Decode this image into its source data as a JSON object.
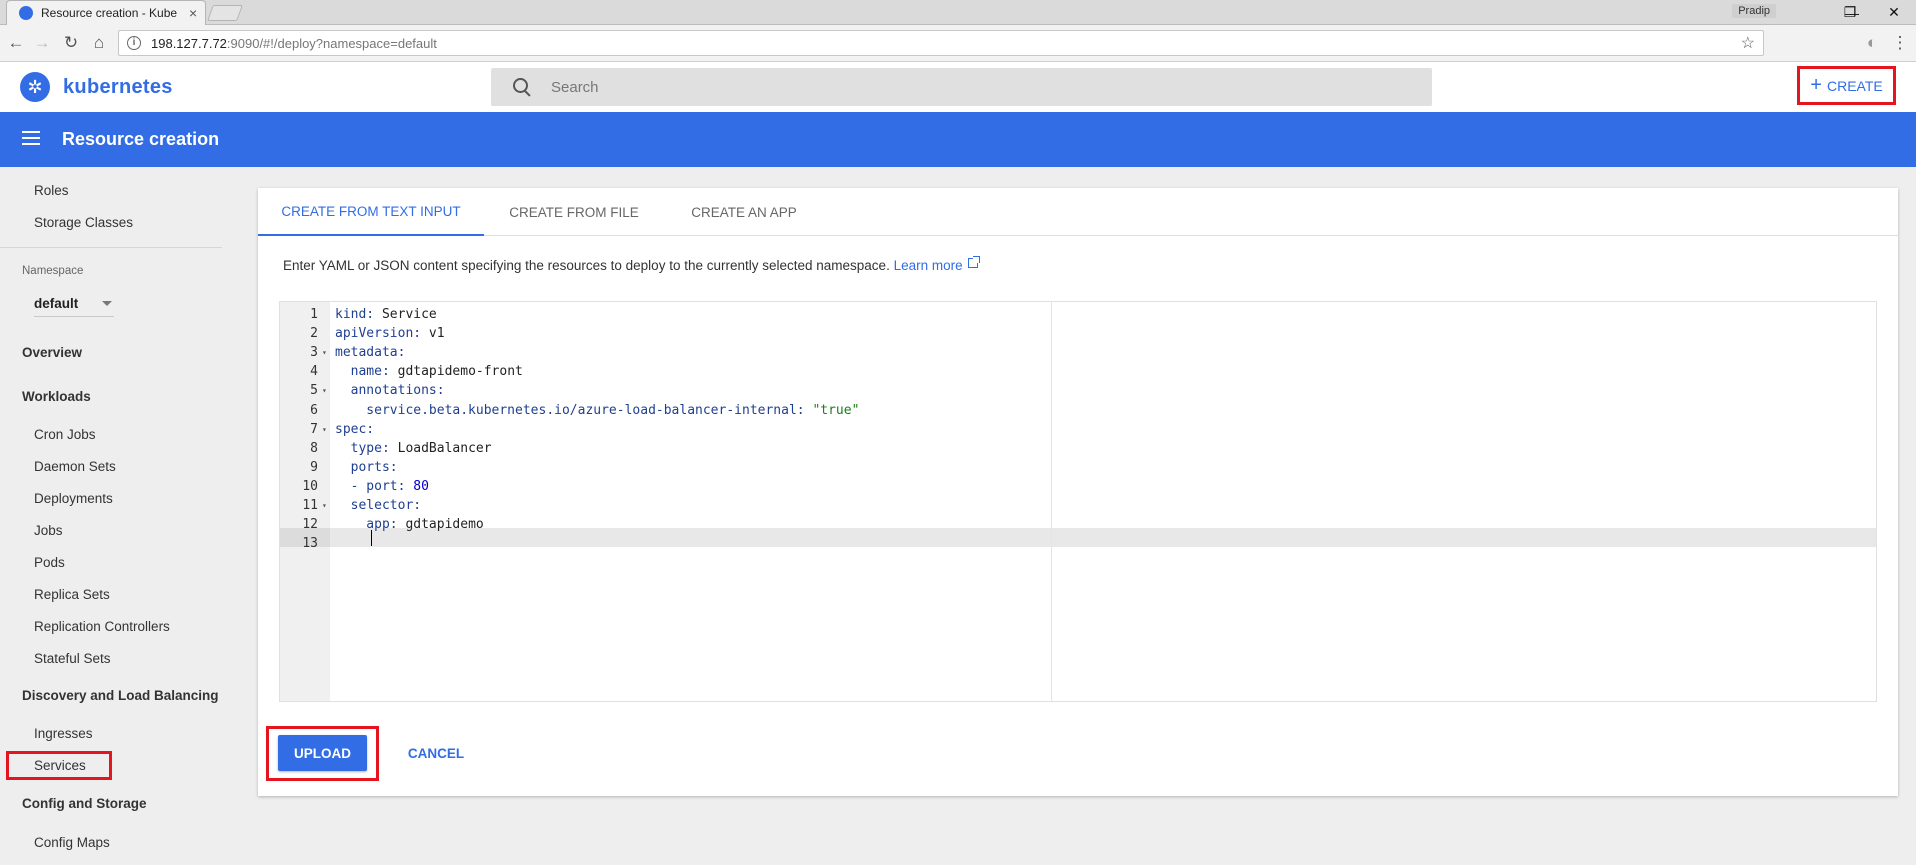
{
  "browser": {
    "tab_title": "Resource creation - Kube",
    "tab_close": "×",
    "user": "Pradip",
    "url_host": "198.127.7.72",
    "url_rest": ":9090/#!/deploy?namespace=default",
    "nav": {
      "back": "←",
      "forward": "→",
      "reload": "↻",
      "home": "⌂",
      "star": "☆"
    },
    "win": {
      "minimize": "—",
      "restore": "❐",
      "close": "✕"
    }
  },
  "header": {
    "brand": "kubernetes",
    "logo_glyph": "✲",
    "search_placeholder": "Search",
    "create_label": "CREATE",
    "create_plus": "+"
  },
  "toolbar": {
    "title": "Resource creation"
  },
  "sidebar": {
    "top_items": [
      "Roles",
      "Storage Classes"
    ],
    "namespace_label": "Namespace",
    "namespace_value": "default",
    "overview": "Overview",
    "workloads": "Workloads",
    "workload_items": [
      "Cron Jobs",
      "Daemon Sets",
      "Deployments",
      "Jobs",
      "Pods",
      "Replica Sets",
      "Replication Controllers",
      "Stateful Sets"
    ],
    "discovery": "Discovery and Load Balancing",
    "discovery_items": [
      "Ingresses",
      "Services"
    ],
    "config": "Config and Storage",
    "config_items": [
      "Config Maps"
    ]
  },
  "main": {
    "tabs": [
      "CREATE FROM TEXT INPUT",
      "CREATE FROM FILE",
      "CREATE AN APP"
    ],
    "description": "Enter YAML or JSON content specifying the resources to deploy to the currently selected namespace.",
    "learn_more": "Learn more",
    "editor_lines": [
      {
        "n": "1",
        "fold": "",
        "key": "kind: ",
        "val": "Service",
        "cls": "v"
      },
      {
        "n": "2",
        "fold": "",
        "key": "apiVersion: ",
        "val": "v1",
        "cls": "v"
      },
      {
        "n": "3",
        "fold": "▾",
        "key": "metadata:",
        "val": "",
        "cls": "v"
      },
      {
        "n": "4",
        "fold": "",
        "key": "  name: ",
        "val": "gdtapidemo-front",
        "cls": "v"
      },
      {
        "n": "5",
        "fold": "▾",
        "key": "  annotations:",
        "val": "",
        "cls": "v"
      },
      {
        "n": "6",
        "fold": "",
        "key": "    service.beta.kubernetes.io/azure-load-balancer-internal: ",
        "val": "\"true\"",
        "cls": "s"
      },
      {
        "n": "7",
        "fold": "▾",
        "key": "spec:",
        "val": "",
        "cls": "v"
      },
      {
        "n": "8",
        "fold": "",
        "key": "  type: ",
        "val": "LoadBalancer",
        "cls": "v"
      },
      {
        "n": "9",
        "fold": "",
        "key": "  ports:",
        "val": "",
        "cls": "v"
      },
      {
        "n": "10",
        "fold": "",
        "key": "  - port: ",
        "val": "80",
        "cls": "n"
      },
      {
        "n": "11",
        "fold": "▾",
        "key": "  selector:",
        "val": "",
        "cls": "v"
      },
      {
        "n": "12",
        "fold": "",
        "key": "    app: ",
        "val": "gdtapidemo",
        "cls": "v"
      },
      {
        "n": "13",
        "fold": "",
        "key": "",
        "val": "",
        "cls": "v"
      }
    ],
    "upload_label": "UPLOAD",
    "cancel_label": "CANCEL"
  },
  "colors": {
    "accent": "#326de6",
    "highlight": "#e4151f"
  }
}
